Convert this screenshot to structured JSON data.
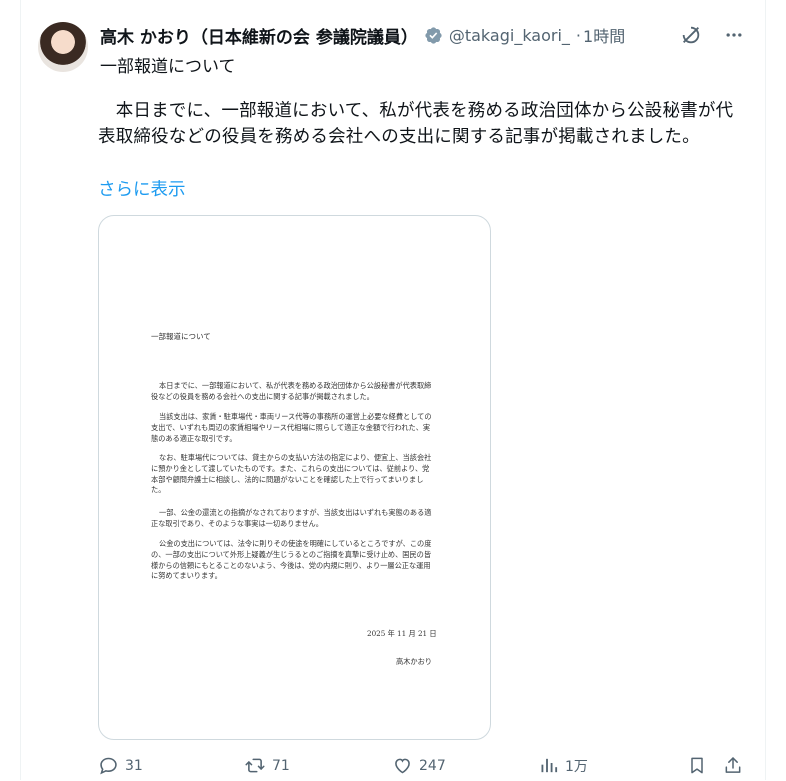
{
  "post": {
    "author_name": "高木 かおり（日本維新の会 参議院議員）",
    "handle": "@takagi_kaori_",
    "time_sep": "·",
    "time": "1時間",
    "subtitle": "一部報道について",
    "body": "　本日までに、一部報道において、私が代表を務める政治団体から公設秘書が代表取締役などの役員を務める会社への支出に関する記事が掲載されました。",
    "show_more": "さらに表示"
  },
  "document": {
    "title": "一部報道について",
    "paragraphs": [
      "本日までに、一部報道において、私が代表を務める政治団体から公設秘書が代表取締役などの役員を務める会社への支出に関する記事が掲載されました。",
      "当該支出は、家賃・駐車場代・車両リース代等の事務所の運営上必要な経費としての支出で、いずれも周辺の家賃相場やリース代相場に照らして適正な金額で行われた、実態のある適正な取引です。",
      "なお、駐車場代については、貸主からの支払い方法の指定により、便宜上、当該会社に預かり金として渡していたものです。また、これらの支出については、従前より、党本部や顧問弁護士に相談し、法的に問題がないことを確認した上で行ってまいりました。",
      "一部、公金の還流との指摘がなされておりますが、当該支出はいずれも実態のある適正な取引であり、そのような事実は一切ありません。",
      "公金の支出については、法令に則りその使途を明確にしているところですが、この度の、一部の支出について外形上疑義が生じうるとのご指摘を真摯に受け止め、国民の皆様からの信頼にもとることのないよう、今後は、党の内規に則り、より一層公正な運用に努めてまいります。"
    ],
    "date": "2025 年 11 月 21 日",
    "signature": "高木かおり"
  },
  "actions": {
    "replies": "31",
    "reposts": "71",
    "likes": "247",
    "views": "1万"
  },
  "icons": {
    "verified": "verified-badge-icon",
    "grok": "grok-icon",
    "more": "more-icon",
    "reply": "reply-icon",
    "repost": "repost-icon",
    "like": "heart-icon",
    "views": "views-icon",
    "bookmark": "bookmark-icon",
    "share": "share-icon"
  },
  "colors": {
    "link": "#1d9bf0",
    "secondary_text": "#536471",
    "verified_badge": "#829aab"
  }
}
